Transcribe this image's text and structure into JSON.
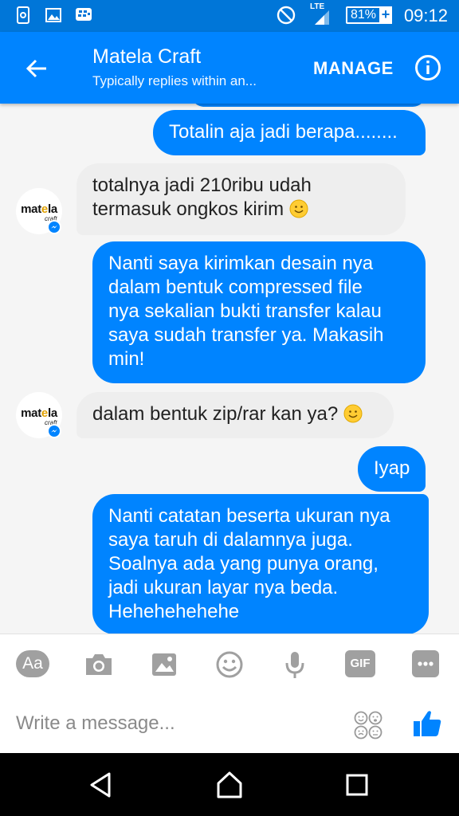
{
  "status_bar": {
    "lte": "LTE",
    "battery": "81%",
    "time": "09:12"
  },
  "header": {
    "title": "Matela Craft",
    "subtitle": "Typically replies within an...",
    "manage_label": "MANAGE"
  },
  "avatar": {
    "logo_text_1": "mat",
    "logo_text_2": "e",
    "logo_text_3": "la",
    "logo_sub": "craft"
  },
  "messages": [
    {
      "from": "me",
      "text": "Totalin aja jadi berapa........"
    },
    {
      "from": "them",
      "line1": "totalnya jadi 210ribu udah",
      "line2": "termasuk ongkos kirim"
    },
    {
      "from": "me",
      "line1": "Nanti saya kirimkan desain nya",
      "line2": "dalam bentuk compressed file",
      "line3": "nya sekalian bukti transfer kalau",
      "line4": "saya sudah transfer ya. Makasih",
      "line5": "min!"
    },
    {
      "from": "them",
      "text": "dalam bentuk zip/rar kan ya?"
    },
    {
      "from": "me",
      "text": "Iyap"
    },
    {
      "from": "me",
      "line1": "Nanti catatan beserta ukuran nya",
      "line2": "saya taruh di dalamnya juga.",
      "line3": "Soalnya ada yang punya orang,",
      "line4": "jadi ukuran layar nya beda.",
      "line5": "Hehehehehehe"
    }
  ],
  "composer": {
    "aa_label": "Aa",
    "gif_label": "GIF",
    "placeholder": "Write a message..."
  },
  "colors": {
    "brand": "#0084ff",
    "status": "#0076d8",
    "incoming": "#eeeeee"
  }
}
